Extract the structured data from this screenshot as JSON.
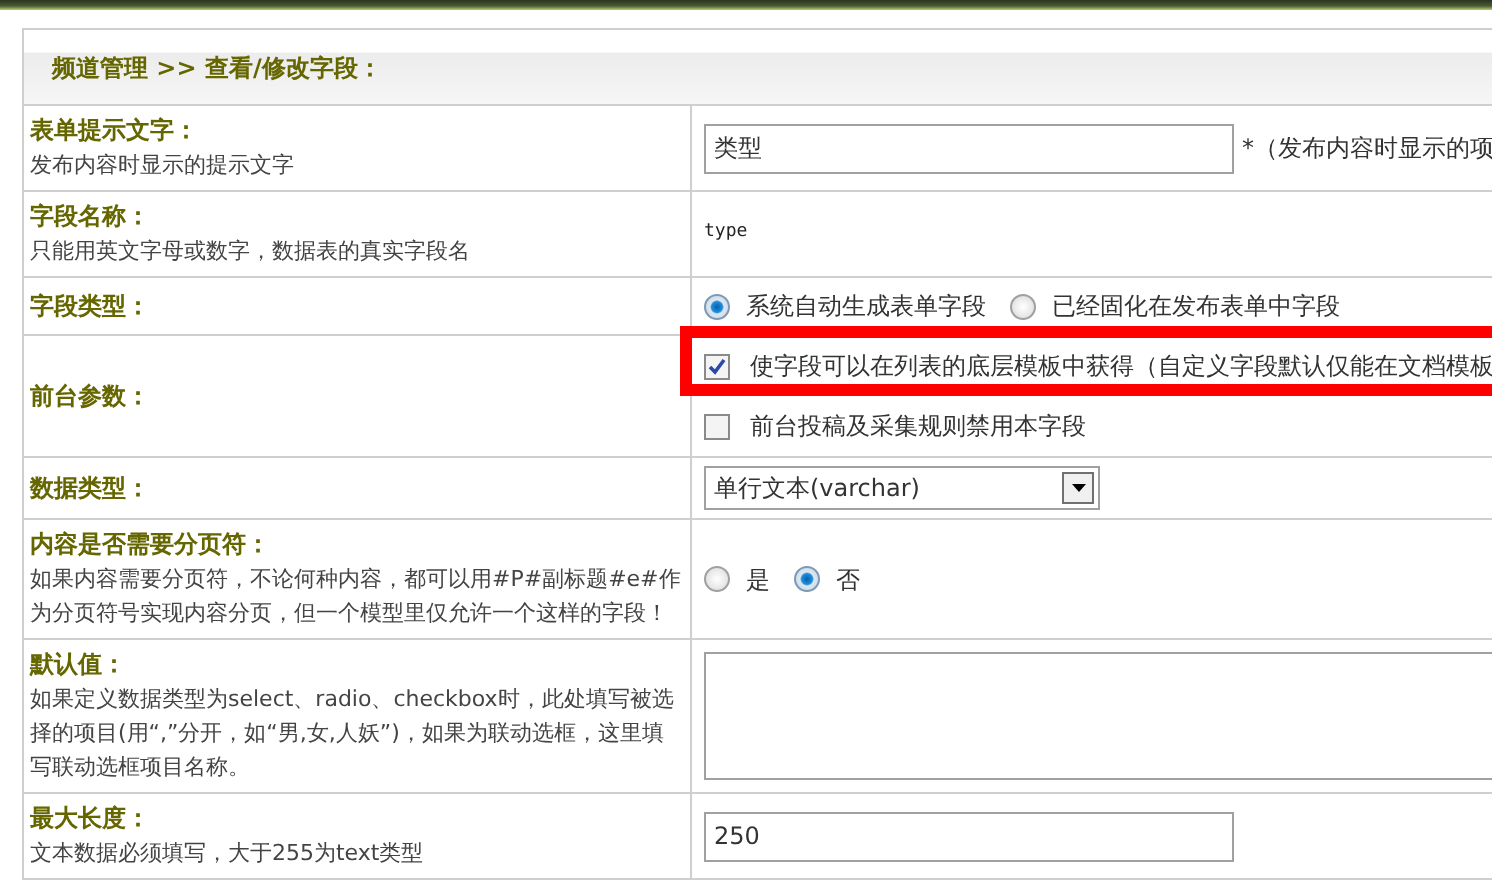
{
  "header": {
    "title": "频道管理 >> 查看/修改字段："
  },
  "fields": [
    {
      "kind": "text_input",
      "label": "表单提示文字：",
      "description": "发布内容时显示的提示文字",
      "value": "类型",
      "note": "*（发布内容时显示的项"
    },
    {
      "kind": "plain",
      "label": "字段名称：",
      "description": "只能用英文字母或数字，数据表的真实字段名",
      "value": "type"
    },
    {
      "kind": "radio",
      "label": "字段类型：",
      "options": [
        {
          "label": "系统自动生成表单字段",
          "selected": true
        },
        {
          "label": "已经固化在发布表单中字段",
          "selected": false
        }
      ]
    },
    {
      "kind": "checkbox",
      "label": "前台参数：",
      "highlighted": true,
      "options": [
        {
          "label": "使字段可以在列表的底层模板中获得（自定义字段默认仅能在文档模板",
          "checked": true
        },
        {
          "label": "前台投稿及采集规则禁用本字段",
          "checked": false
        }
      ]
    },
    {
      "kind": "select",
      "label": "数据类型：",
      "value": "单行文本(varchar)"
    },
    {
      "kind": "radio",
      "label": "内容是否需要分页符：",
      "description": "如果内容需要分页符，不论何种内容，都可以用#P#副标题#e#作为分页符号实现内容分页，但一个模型里仅允许一个这样的字段！",
      "options": [
        {
          "label": "是",
          "selected": false
        },
        {
          "label": "否",
          "selected": true
        }
      ]
    },
    {
      "kind": "textarea",
      "label": "默认值：",
      "description": "如果定义数据类型为select、radio、checkbox时，此处填写被选择的项目(用“,”分开，如“男,女,人妖”)，如果为联动选框，这里填写联动选框项目名称。"
    },
    {
      "kind": "text_input",
      "label": "最大长度：",
      "description": "文本数据必须填写，大于255为text类型",
      "value": "250"
    }
  ]
}
